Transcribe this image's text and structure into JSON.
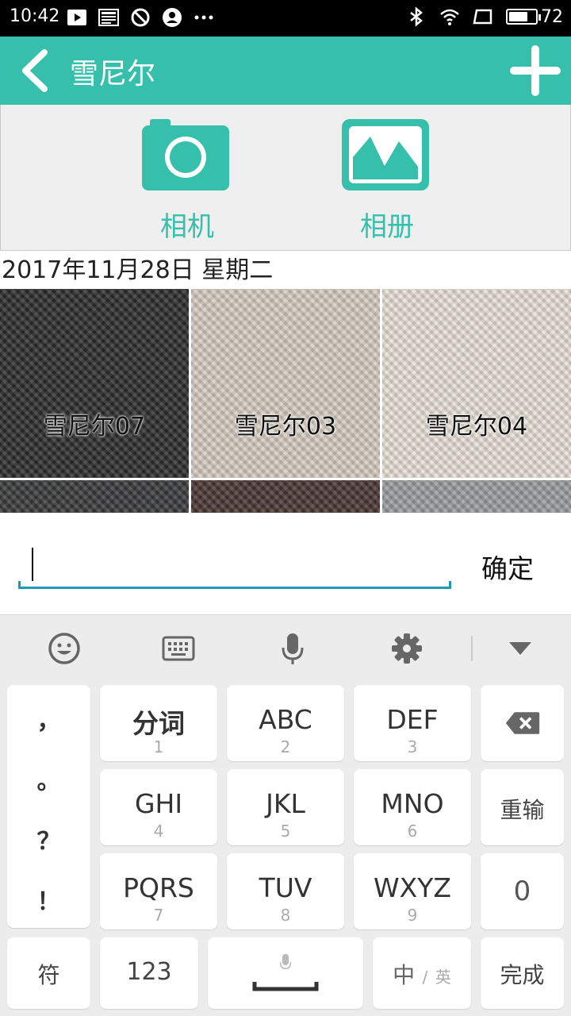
{
  "status_bar": {
    "time": "10:42",
    "battery_pct": "72",
    "battery_level": 0.72,
    "left_icons": [
      "play-icon",
      "news-icon",
      "blocked-icon",
      "account-icon",
      "more-dots-icon"
    ],
    "right_icons": [
      "bluetooth-icon",
      "wifi-icon",
      "screen-icon",
      "battery-icon"
    ]
  },
  "title_bar": {
    "title": "雪尼尔",
    "back_icon": "chevron-left-icon",
    "add_icon": "plus-icon",
    "color": "#36c0ab"
  },
  "source_panel": {
    "camera_label": "相机",
    "album_label": "相册",
    "accent": "#36c0ab"
  },
  "date_header": "2017年11月28日 星期二",
  "grid": {
    "tiles": [
      {
        "label": "雪尼尔07",
        "color": "#2e2e2e"
      },
      {
        "label": "雪尼尔03",
        "color": "#d6ccc1"
      },
      {
        "label": "雪尼尔04",
        "color": "#e6e0d6"
      },
      {
        "label": "",
        "color": "#3a3b3c"
      },
      {
        "label": "",
        "color": "#4a3634"
      },
      {
        "label": "",
        "color": "#9a9c9f"
      }
    ]
  },
  "input": {
    "value": "",
    "confirm_label": "确定",
    "underline_color": "#1f98b3"
  },
  "keyboard": {
    "toolbar_icons": [
      "emoji-icon",
      "keyboard-icon",
      "microphone-icon",
      "settings-gear-icon",
      "collapse-down-icon"
    ],
    "punctuation": [
      "，",
      "。",
      "？",
      "！"
    ],
    "keys": {
      "fenci": {
        "label": "分词",
        "sub": "1"
      },
      "abc": {
        "label": "ABC",
        "sub": "2"
      },
      "def": {
        "label": "DEF",
        "sub": "3"
      },
      "ghi": {
        "label": "GHI",
        "sub": "4"
      },
      "jkl": {
        "label": "JKL",
        "sub": "5"
      },
      "mno": {
        "label": "MNO",
        "sub": "6"
      },
      "pqrs": {
        "label": "PQRS",
        "sub": "7"
      },
      "tuv": {
        "label": "TUV",
        "sub": "8"
      },
      "wxyz": {
        "label": "WXYZ",
        "sub": "9"
      },
      "reinput": "重输",
      "zero": "0",
      "symbols": "符",
      "num123": "123",
      "lang_zh": "中",
      "lang_sep": "/",
      "lang_en": "英",
      "done": "完成"
    }
  }
}
